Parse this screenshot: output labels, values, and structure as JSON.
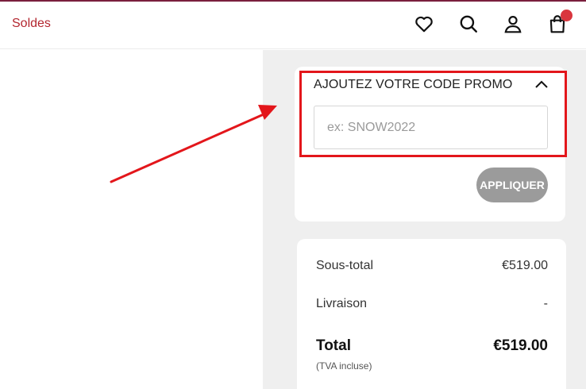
{
  "header": {
    "soldes_label": "Soldes",
    "icons": [
      "heart-icon",
      "search-icon",
      "user-icon",
      "bag-icon"
    ]
  },
  "promo": {
    "title": "AJOUTEZ VOTRE CODE PROMO",
    "placeholder": "ex: SNOW2022",
    "apply_label": "APPLIQUER"
  },
  "summary": {
    "subtotal_label": "Sous-total",
    "subtotal_value": "€519.00",
    "shipping_label": "Livraison",
    "shipping_value": "-",
    "total_label": "Total",
    "total_value": "€519.00",
    "tax_note": "(TVA incluse)"
  },
  "colors": {
    "brand_red": "#b3262f",
    "badge": "#d9363e",
    "annotation_red": "#e3161b",
    "button_gray": "#9b9b9b",
    "panel_bg": "#efefef"
  }
}
